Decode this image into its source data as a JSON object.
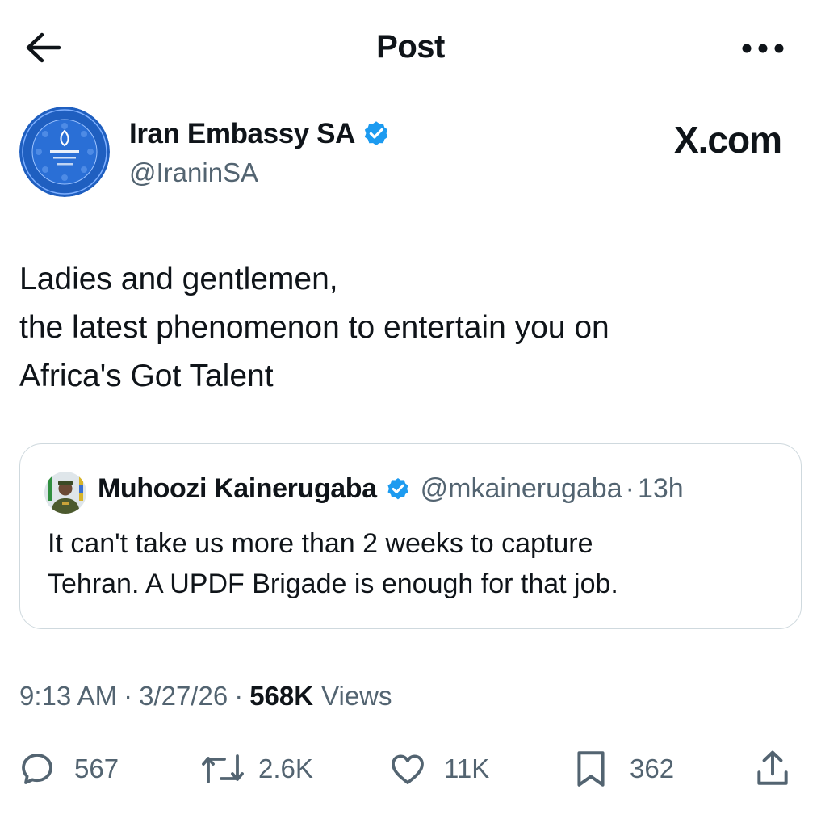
{
  "header": {
    "title": "Post",
    "back_icon": "arrow-left-icon",
    "more_icon": "more-horizontal-icon"
  },
  "author": {
    "name": "Iran Embassy SA",
    "handle": "@IraninSA",
    "verified": true,
    "avatar": "embassy-emblem"
  },
  "brand": "X.com",
  "tweet": {
    "lines": [
      "Ladies and gentlemen,",
      "the latest phenomenon to entertain you on",
      "Africa's Got Talent"
    ]
  },
  "quote": {
    "name": "Muhoozi Kainerugaba",
    "handle": "@mkainerugaba",
    "separator": "·",
    "time": "13h",
    "verified": true,
    "lines": [
      "It can't take us more than 2 weeks to capture",
      "Tehran. A UPDF Brigade is enough for that job."
    ]
  },
  "meta": {
    "time": "9:13 AM",
    "separator": "·",
    "date": "3/27/26",
    "views_count": "568K",
    "views_label": "Views"
  },
  "actions": {
    "replies": "567",
    "reposts": "2.6K",
    "likes": "11K",
    "bookmarks": "362"
  },
  "colors": {
    "text": "#0f1419",
    "secondary": "#536471",
    "verified_blue": "#1d9bf0",
    "emblem_blue": "#1f5fc0",
    "border": "#cfd9de"
  }
}
